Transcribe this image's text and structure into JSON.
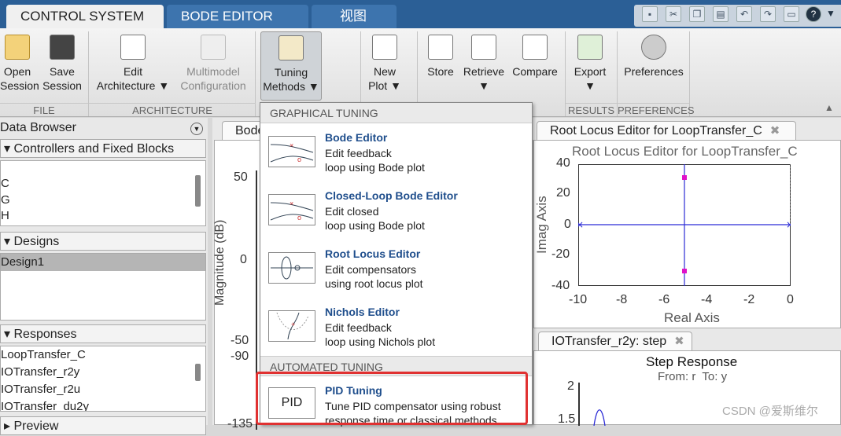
{
  "top_tabs": [
    {
      "label": "CONTROL SYSTEM"
    },
    {
      "label": "BODE EDITOR"
    },
    {
      "label": "视图"
    }
  ],
  "ribbon": {
    "open": {
      "line1": "Open",
      "line2": "Session"
    },
    "save": {
      "line1": "Save",
      "line2": "Session"
    },
    "edit": {
      "line1": "Edit",
      "line2": "Architecture ▼"
    },
    "multimodel": {
      "line1": "Multimodel",
      "line2": "Configuration"
    },
    "tuning": {
      "line1": "Tuning",
      "line2": "Methods ▼"
    },
    "newplot": {
      "line1": "New",
      "line2": "Plot ▼"
    },
    "store": {
      "line1": "Store"
    },
    "retrieve": {
      "line1": "Retrieve",
      "line2": "▼"
    },
    "compare": {
      "line1": "Compare"
    },
    "export": {
      "line1": "Export",
      "line2": "▼"
    },
    "preferences": {
      "line1": "Preferences"
    },
    "sections": {
      "file": "FILE",
      "architecture": "ARCHITECTURE",
      "results": "RESULTS",
      "preferences": "PREFERENCES"
    }
  },
  "left_panel": {
    "title": "Data Browser",
    "controllers_header": "Controllers and Fixed Blocks",
    "controllers_items": [
      "C",
      "G",
      "H"
    ],
    "designs_header": "Designs",
    "designs_items": [
      "Design1"
    ],
    "responses_header": "Responses",
    "responses_items": [
      "LoopTransfer_C",
      "IOTransfer_r2y",
      "IOTransfer_r2u",
      "IOTransfer_du2y"
    ],
    "preview_header": "Preview"
  },
  "bode_doc": {
    "tab_label": "Bode",
    "ylabel": "Magnitude (dB)",
    "ticks_mag": [
      "50",
      "0",
      "-50"
    ],
    "ticks_phase": [
      "-90",
      "-135"
    ]
  },
  "rl_doc": {
    "tab_label": "Root Locus Editor for LoopTransfer_C",
    "title": "Root Locus Editor for LoopTransfer_C",
    "xlabel": "Real Axis",
    "ylabel": "Imag Axis",
    "xticks": [
      "-10",
      "-8",
      "-6",
      "-4",
      "-2",
      "0"
    ],
    "yticks": [
      "40",
      "20",
      "0",
      "-20",
      "-40"
    ]
  },
  "step_doc": {
    "tab_label": "IOTransfer_r2y: step",
    "title": "Step Response",
    "subtitle": "From: r  To: y",
    "yticks": [
      "2",
      "1.5"
    ]
  },
  "dropdown": {
    "graphical_header": "GRAPHICAL TUNING",
    "automated_header": "AUTOMATED TUNING",
    "items": [
      {
        "title": "Bode Editor",
        "line1": "Edit feedback",
        "line2": "loop using Bode plot"
      },
      {
        "title": "Closed-Loop Bode Editor",
        "line1": "Edit closed",
        "line2": "loop using Bode plot"
      },
      {
        "title": "Root Locus Editor",
        "line1": "Edit compensators",
        "line2": "using root locus plot"
      },
      {
        "title": "Nichols Editor",
        "line1": "Edit feedback",
        "line2": "loop using Nichols plot"
      }
    ],
    "pid": {
      "icon_text": "PID",
      "title": "PID Tuning",
      "line1": "Tune PID compensator using robust",
      "line2": "response time or classical methods"
    }
  },
  "watermark": "CSDN @爱斯维尔"
}
